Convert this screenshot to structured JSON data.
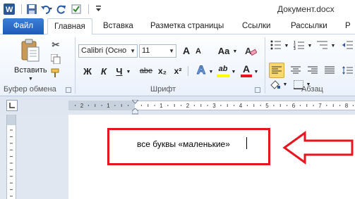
{
  "window": {
    "title": "Документ.docx"
  },
  "tabs": [
    {
      "label": "Файл"
    },
    {
      "label": "Главная"
    },
    {
      "label": "Вставка"
    },
    {
      "label": "Разметка страницы"
    },
    {
      "label": "Ссылки"
    },
    {
      "label": "Рассылки"
    },
    {
      "label": "Р"
    }
  ],
  "ribbon": {
    "clipboard": {
      "paste_label": "Вставить",
      "group_label": "Буфер обмена"
    },
    "font": {
      "font_name": "Calibri (Осно",
      "font_size": "11",
      "group_label": "Шрифт",
      "grow_label": "A",
      "shrink_label": "A",
      "case_label": "Aa",
      "bold_label": "Ж",
      "italic_label": "К",
      "underline_label": "Ч",
      "strike_label": "abe",
      "sub_label": "x₂",
      "sup_label": "x²",
      "effects_label": "A",
      "highlight_label": "ab",
      "color_label": "A"
    },
    "paragraph": {
      "group_label": "Абзац"
    }
  },
  "document": {
    "text": "все  буквы «маленькие»"
  },
  "colors": {
    "accent": "#2b5797",
    "annotation": "#e8141e",
    "file_tab": "#2a6acb"
  }
}
